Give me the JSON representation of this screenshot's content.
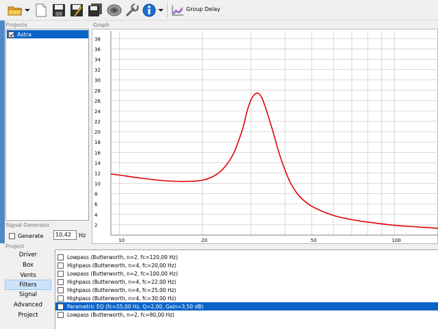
{
  "toolbar": {
    "icons": [
      "open-folder-icon",
      "dropdown-arrow-icon",
      "new-document-icon",
      "save-icon",
      "edit-save-icon",
      "save-all-icon",
      "speaker-icon",
      "wrench-icon",
      "info-icon",
      "dropdown-arrow-icon",
      "graph-icon"
    ],
    "group_delay_label": "Group Delay"
  },
  "projects": {
    "title": "Projects",
    "items": [
      {
        "label": "Astra",
        "checked": true,
        "selected": true
      }
    ]
  },
  "graph": {
    "title": "Graph"
  },
  "signal_generator": {
    "title": "Signal Generator",
    "generate_label": "Generate",
    "frequency_value": "10,42",
    "frequency_unit": "Hz"
  },
  "project_nav": {
    "title": "Project",
    "items": [
      "Driver",
      "Box",
      "Vents",
      "Filters",
      "Signal",
      "Advanced",
      "Project"
    ],
    "active": "Filters"
  },
  "filters": [
    {
      "label": "Lowpass (Butterworth, n=2, fc=120,00 Hz)",
      "checked": false,
      "selected": false
    },
    {
      "label": "Highpass (Butterworth, n=4, fc=20,00 Hz)",
      "checked": false,
      "selected": false
    },
    {
      "label": "Lowpass (Butterworth, n=2, fc=100,00 Hz)",
      "checked": false,
      "selected": false
    },
    {
      "label": "Highpass (Butterworth, n=4, fc=22,00 Hz)",
      "checked": false,
      "selected": false
    },
    {
      "label": "Highpass (Butterworth, n=4, fc=25,00 Hz)",
      "checked": false,
      "selected": false
    },
    {
      "label": "Highpass (Butterworth, n=4, fc=30,00 Hz)",
      "checked": false,
      "selected": false
    },
    {
      "label": "Parametric EQ (fc=55,00 Hz, Q=2,00, Gain=3,50 dB)",
      "checked": false,
      "selected": true
    },
    {
      "label": "Lowpass (Butterworth, n=2, fc=80,00 Hz)",
      "checked": false,
      "selected": false
    }
  ],
  "colors": {
    "selection": "#0a64c8",
    "curve": "#e00000",
    "grid": "#c8c8c8"
  },
  "chart_data": {
    "type": "line",
    "title": "",
    "xlabel": "",
    "ylabel": "",
    "x_scale": "log",
    "xlim": [
      9.3,
      145
    ],
    "ylim": [
      0,
      39.5
    ],
    "x_ticks": [
      10,
      20,
      50,
      100
    ],
    "x_tick_labels": [
      "10",
      "20",
      "50",
      "100"
    ],
    "x_minor_gridlines": [
      30,
      40,
      60,
      70,
      80,
      90,
      200
    ],
    "y_ticks": [
      2,
      4,
      6,
      8,
      10,
      12,
      14,
      16,
      18,
      20,
      22,
      24,
      26,
      28,
      30,
      32,
      34,
      36,
      38
    ],
    "y_tick_labels": [
      "2",
      "4",
      "6",
      "8",
      "10",
      "12",
      "14",
      "16",
      "18",
      "20",
      "22",
      "24",
      "26",
      "28",
      "30",
      "32",
      "34",
      "36",
      "38"
    ],
    "grid": true,
    "series": [
      {
        "x": [
          9.3,
          10,
          12,
          14,
          16,
          18,
          20,
          22,
          24,
          26,
          28,
          29,
          30,
          31,
          32,
          33,
          34,
          36,
          38,
          40,
          42,
          45,
          50,
          60,
          70,
          80,
          100,
          120,
          145
        ],
        "y": [
          11.8,
          11.6,
          11.0,
          10.6,
          10.4,
          10.4,
          10.6,
          11.4,
          13.0,
          15.8,
          20.4,
          23.6,
          26.0,
          27.2,
          27.4,
          26.5,
          24.6,
          20.4,
          16.0,
          12.6,
          10.0,
          7.6,
          5.6,
          3.8,
          3.0,
          2.5,
          1.9,
          1.6,
          1.3
        ]
      }
    ]
  }
}
